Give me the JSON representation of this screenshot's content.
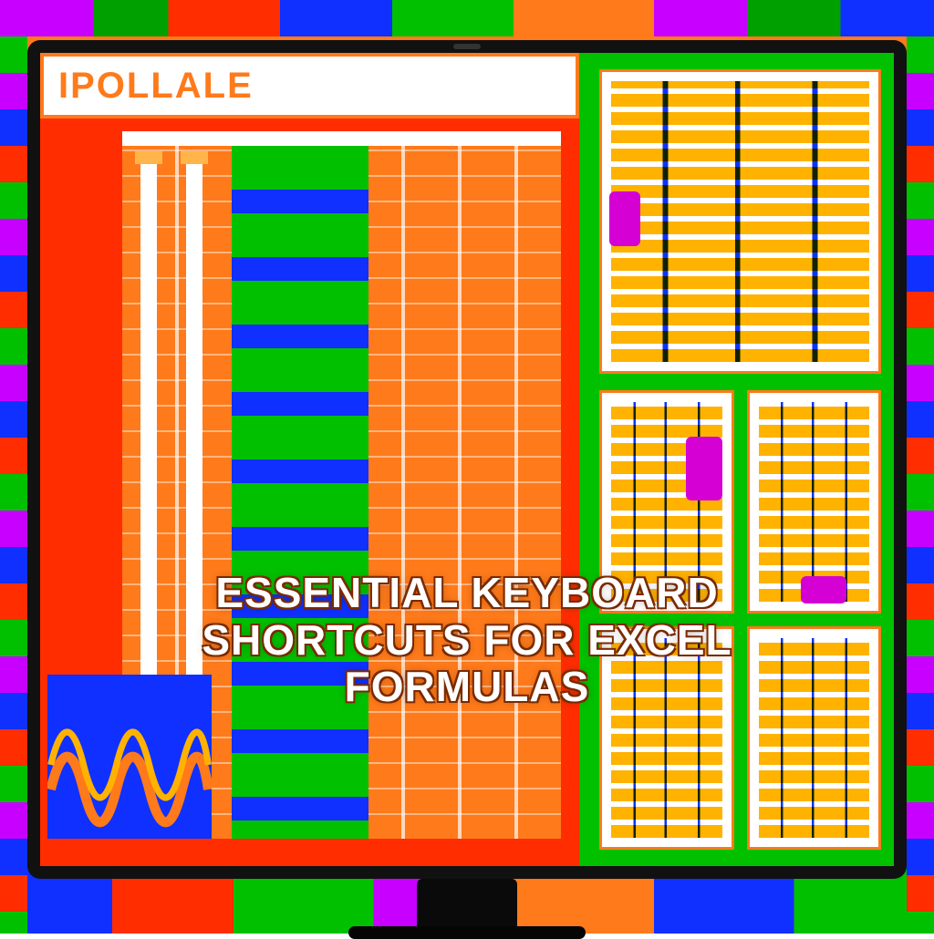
{
  "header": {
    "brand": "IPOLLALE"
  },
  "title": {
    "line1": "ESSENTIAL KEYBOARD",
    "line2": "SHORTCUTS FOR EXCEL",
    "line3": "FORMULAS"
  },
  "colors": {
    "orange": "#ff7a1a",
    "red": "#ff2d00",
    "green": "#00c000",
    "blue": "#1030ff",
    "magenta": "#d400d4",
    "yellow": "#ffb200"
  }
}
